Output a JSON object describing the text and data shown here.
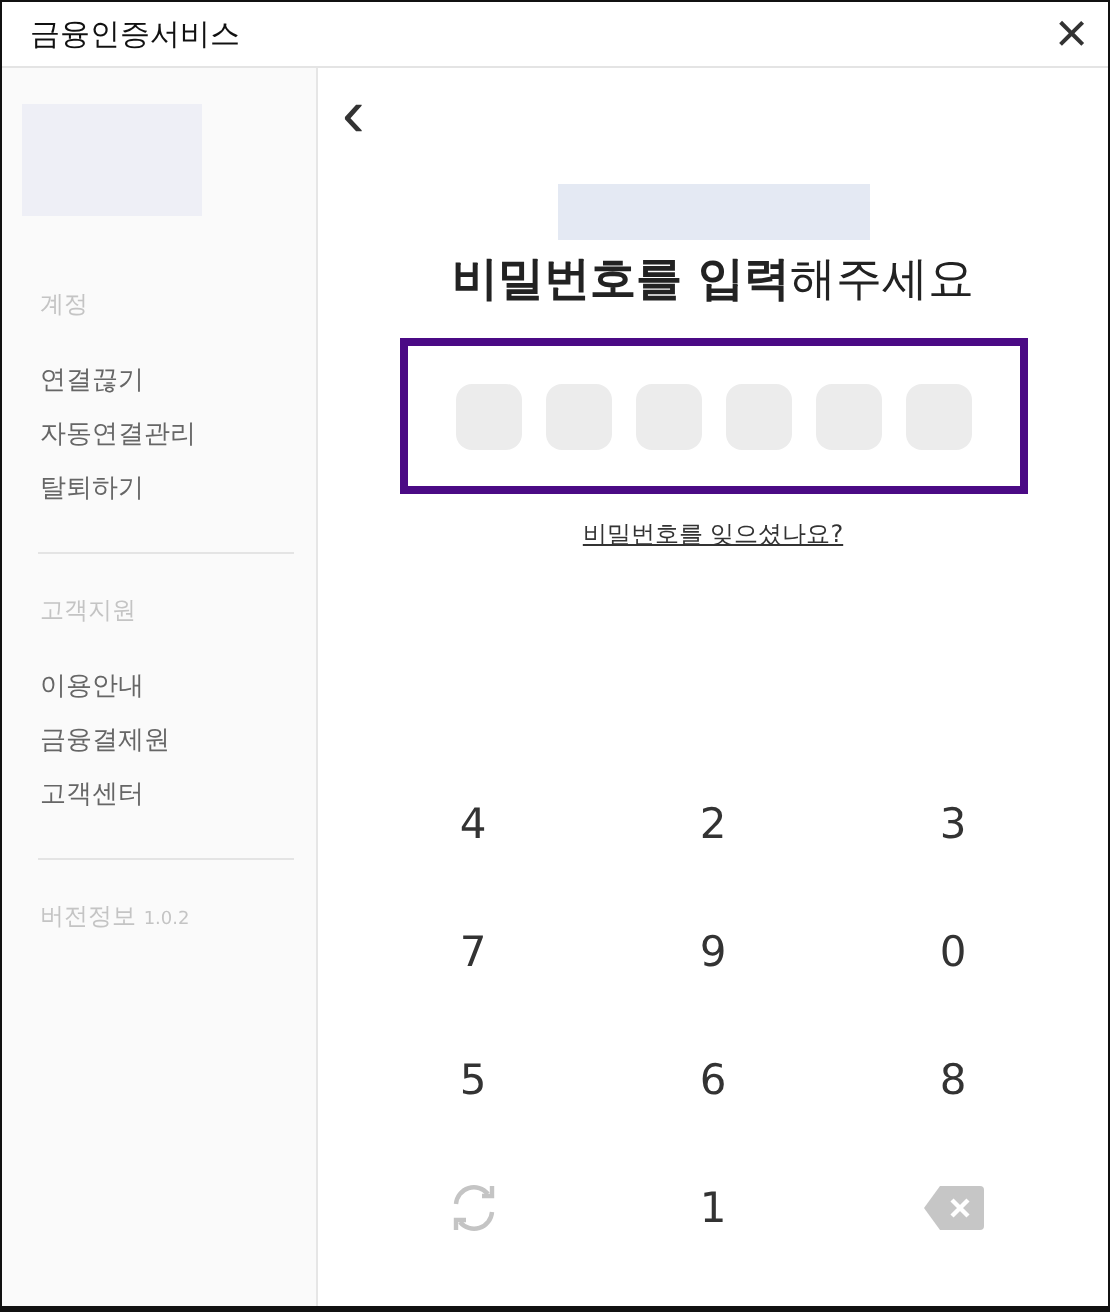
{
  "window": {
    "title": "금융인증서비스",
    "close": "×"
  },
  "sidebar": {
    "sections": [
      {
        "heading": "계정",
        "items": [
          "연결끊기",
          "자동연결관리",
          "탈퇴하기"
        ]
      },
      {
        "heading": "고객지원",
        "items": [
          "이용안내",
          "금융결제원\n고객센터"
        ]
      }
    ],
    "version": {
      "label": "버전정보",
      "number": "1.0.2"
    }
  },
  "main": {
    "back": "‹",
    "heading": "**비밀번호를 입력**해주세요",
    "pin": [
      {
        "filled": false
      },
      {
        "filled": false
      },
      {
        "filled": false
      },
      {
        "filled": false
      },
      {
        "filled": false
      },
      {
        "filled": false
      }
    ],
    "forgot_link": "비밀번호를 잊으셨나요?",
    "keys": [
      {
        "kind": "digit",
        "label": "4"
      },
      {
        "kind": "digit",
        "label": "2"
      },
      {
        "kind": "digit",
        "label": "3"
      },
      {
        "kind": "digit",
        "label": "7"
      },
      {
        "kind": "digit",
        "label": "9"
      },
      {
        "kind": "digit",
        "label": "0"
      },
      {
        "kind": "digit",
        "label": "5"
      },
      {
        "kind": "digit",
        "label": "6"
      },
      {
        "kind": "digit",
        "label": "8"
      },
      {
        "kind": "shuffle"
      },
      {
        "kind": "digit",
        "label": "1"
      },
      {
        "kind": "backspace"
      }
    ]
  }
}
